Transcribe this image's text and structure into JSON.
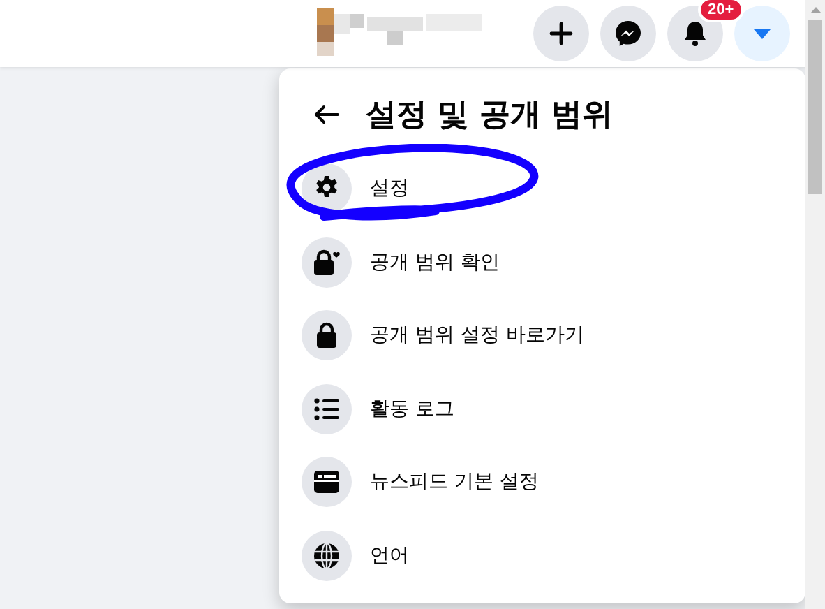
{
  "top_bar": {
    "buttons": [
      {
        "kind": "plus"
      },
      {
        "kind": "messenger"
      },
      {
        "kind": "bell",
        "badge": "20+"
      },
      {
        "kind": "caret",
        "selected": true
      }
    ]
  },
  "menu": {
    "title": "설정 및 공개 범위",
    "items": [
      {
        "label": "설정",
        "circled": true
      },
      {
        "label": "공개 범위 확인",
        "circled": false
      },
      {
        "label": "공개 범위 설정 바로가기",
        "circled": false
      },
      {
        "label": "활동 로그",
        "circled": false
      },
      {
        "label": "뉴스피드 기본 설정",
        "circled": false
      },
      {
        "label": "언어",
        "circled": false
      }
    ]
  }
}
